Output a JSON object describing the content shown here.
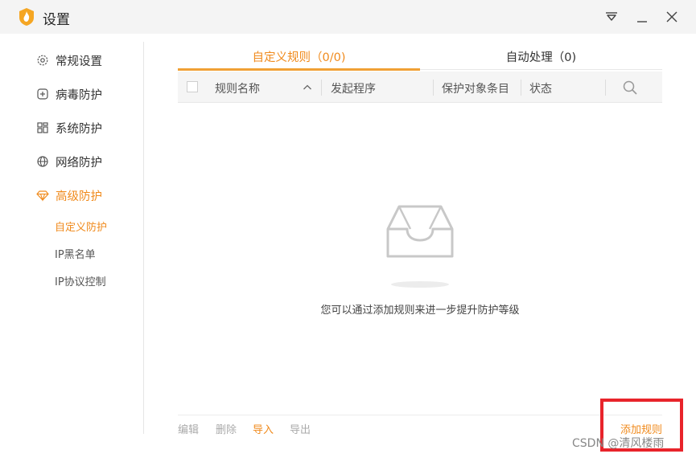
{
  "window": {
    "title": "设置",
    "accent_color": "#f08a1c"
  },
  "sidebar": {
    "items": [
      {
        "label": "常规设置",
        "icon": "gear-icon"
      },
      {
        "label": "病毒防护",
        "icon": "plus-square-icon"
      },
      {
        "label": "系统防护",
        "icon": "grid-icon"
      },
      {
        "label": "网络防护",
        "icon": "globe-icon"
      },
      {
        "label": "高级防护",
        "icon": "diamond-icon",
        "active": true
      }
    ],
    "subitems": [
      {
        "label": "自定义防护",
        "active": true
      },
      {
        "label": "IP黑名单"
      },
      {
        "label": "IP协议控制"
      }
    ]
  },
  "tabs": [
    {
      "label": "自定义规则（0/0)",
      "active": true
    },
    {
      "label": "自动处理（0)"
    }
  ],
  "table": {
    "columns": [
      "规则名称",
      "发起程序",
      "保护对象条目",
      "状态"
    ]
  },
  "empty_state": {
    "icon": "empty-inbox-icon",
    "message": "您可以通过添加规则来进一步提升防护等级"
  },
  "footer": {
    "actions": [
      "编辑",
      "删除",
      "导入",
      "导出"
    ],
    "add_rule": "添加规则"
  },
  "watermark": "CSDN @清风楼雨"
}
